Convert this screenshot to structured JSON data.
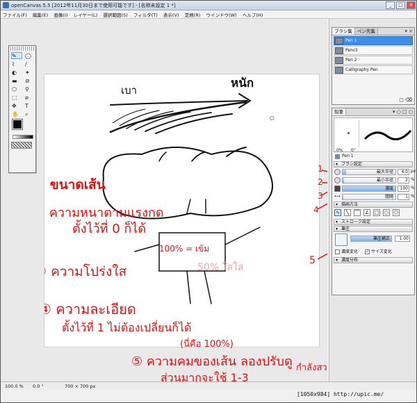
{
  "window": {
    "title": "openCanvas 5.5 [2012年11月30日まで使用可能です] - [名称未設定 1 *]",
    "buttons": [
      "_",
      "□",
      "×"
    ]
  },
  "menu": [
    "ファイル(F)",
    "編集(E)",
    "画像(I)",
    "レイヤー(L)",
    "選択範囲(S)",
    "フィルタ(T)",
    "表示(V)",
    "定規(R)",
    "ウインドウ(W)",
    "ヘルプ(H)"
  ],
  "toolbox": {
    "tools": [
      "✎",
      "◯",
      "⌇",
      "∕",
      "◐",
      "✦",
      "▬",
      "⊘",
      "⬡",
      "⚲",
      "⬚",
      "⌀",
      "✥",
      "T",
      "✋",
      "⌕"
    ]
  },
  "canvas": {
    "sketch_labels": {
      "light": "เบา",
      "heavy": "หนัก",
      "hundred": "100% = เข้ม",
      "fifty": "50% ใสใส"
    },
    "notes": [
      "① ขนาดเส้น",
      "② ความหนาตามแรงกด",
      "ตั้งไว้ที่ 0 ก็ได้",
      "③ ความโปร่งใส",
      "④ ความละเอียด",
      "ตั้งไว้ที่ 1 ไม่ต้องเปลี่ยนก็ได้",
      "(นี่คือ 100%)",
      "⑤ ความคมของเส้น ลองปรับดู",
      "ส่วนมากจะใช้ 1-3",
      "กำลังสวย"
    ],
    "side_numbers": [
      "1",
      "2",
      "3",
      "4",
      "5"
    ]
  },
  "brush_panel": {
    "tabs": [
      "ブラシ集",
      "ペン先集"
    ],
    "items": [
      "Pen 1",
      "Pencil",
      "Pen 2",
      "Calligraphy Pen"
    ],
    "selected": "Pen 1"
  },
  "pen_panel": {
    "tab": "鉛筆",
    "preview_min": "0%",
    "preview_max": "0°",
    "current_brush": "Pen 1",
    "brush_settings_header": "ブラシ設定",
    "settings": [
      {
        "label": "最大半径",
        "value": "4.0",
        "unit": "px",
        "fill": 0.06
      },
      {
        "label": "最小半径",
        "value": "2",
        "unit": "%",
        "fill": 0.02
      },
      {
        "label": "濃度",
        "value": "100",
        "unit": "%",
        "fill": 1.0
      },
      {
        "label": "間隔",
        "value": "1",
        "unit": "%",
        "fill": 0.01
      }
    ],
    "drawing_method_header": "描画方法",
    "stroke_header": "ストローク設定",
    "pressure_header": "筆圧",
    "pressure_label": "筆圧補正",
    "pressure_value": "1.00",
    "density_change": "濃度変化",
    "size_change": "サイズ変化",
    "density_dist_header": "濃度分布"
  },
  "status": {
    "zoom": "100.0 %",
    "angle": "0.0 °",
    "size": "700 × 700 px"
  },
  "watermark": "[1050x984] http://upic.me/",
  "colors": {
    "annotation": "#ee1111",
    "selected": "#3d8ee8"
  }
}
